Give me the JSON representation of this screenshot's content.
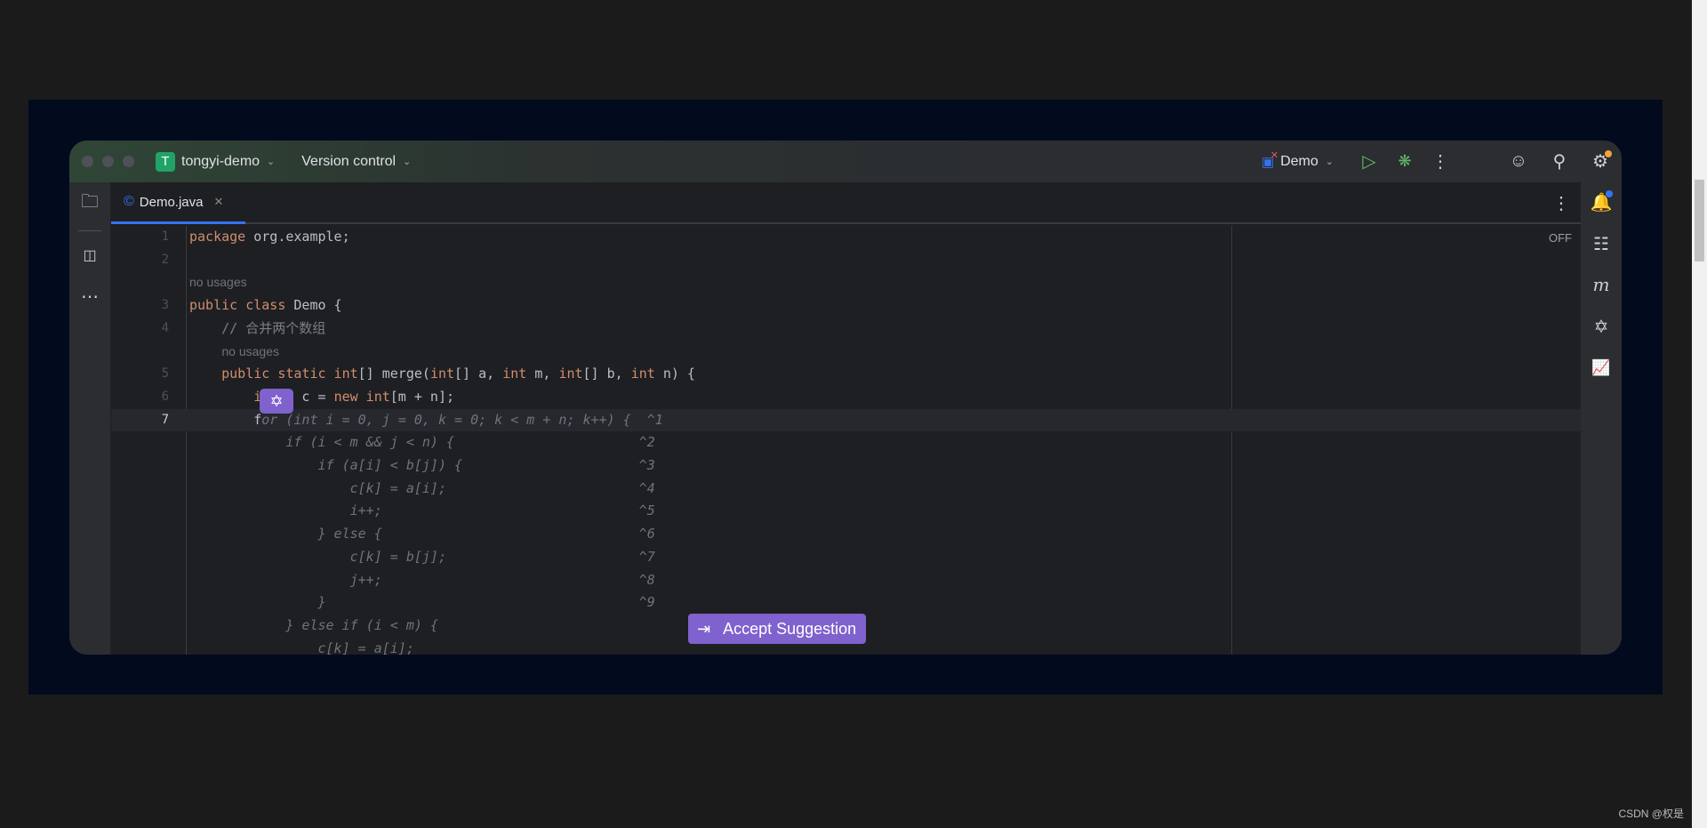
{
  "titlebar": {
    "project_initial": "T",
    "project": "tongyi-demo",
    "vcs": "Version control",
    "run_config": "Demo"
  },
  "tab": {
    "file": "Demo.java"
  },
  "editor": {
    "status": "OFF",
    "rows": [
      {
        "num": "1",
        "tokens": [
          {
            "t": "package ",
            "c": "kw"
          },
          {
            "t": "org.example;",
            "c": "pl"
          }
        ]
      },
      {
        "num": "2",
        "tokens": []
      },
      {
        "num": "",
        "hint": "no usages",
        "indent": 0
      },
      {
        "num": "3",
        "tokens": [
          {
            "t": "public class ",
            "c": "kw"
          },
          {
            "t": "Demo {",
            "c": "pl"
          }
        ]
      },
      {
        "num": "4",
        "tokens": [
          {
            "t": "    // 合并两个数组",
            "c": "cm"
          }
        ]
      },
      {
        "num": "",
        "hint": "no usages",
        "indent": 4
      },
      {
        "num": "5",
        "tokens": [
          {
            "t": "    public static int",
            "c": "kw"
          },
          {
            "t": "[] merge(",
            "c": "pl"
          },
          {
            "t": "int",
            "c": "kw"
          },
          {
            "t": "[] a, ",
            "c": "pl"
          },
          {
            "t": "int",
            "c": "kw"
          },
          {
            "t": " m, ",
            "c": "pl"
          },
          {
            "t": "int",
            "c": "kw"
          },
          {
            "t": "[] b, ",
            "c": "pl"
          },
          {
            "t": "int",
            "c": "kw"
          },
          {
            "t": " n) {",
            "c": "pl"
          }
        ]
      },
      {
        "num": "6",
        "tokens": [
          {
            "t": "        i",
            "c": "kw"
          },
          {
            "t": "nt[] c = ",
            "c": "pl"
          },
          {
            "t": "new int",
            "c": "kw"
          },
          {
            "t": "[m + n];",
            "c": "pl"
          }
        ]
      },
      {
        "num": "7",
        "current": true,
        "tokens": [
          {
            "t": "        f",
            "c": "pl"
          },
          {
            "t": "or (int i = 0, j = 0, k = 0; k < m + n; k++) {  ^1",
            "c": "gh"
          }
        ]
      },
      {
        "num": "",
        "tokens": [
          {
            "t": "            if (i < m && j < n) {                       ^2",
            "c": "gh"
          }
        ]
      },
      {
        "num": "",
        "tokens": [
          {
            "t": "                if (a[i] < b[j]) {                      ^3",
            "c": "gh"
          }
        ]
      },
      {
        "num": "",
        "tokens": [
          {
            "t": "                    c[k] = a[i];                        ^4",
            "c": "gh"
          }
        ]
      },
      {
        "num": "",
        "tokens": [
          {
            "t": "                    i++;                                ^5",
            "c": "gh"
          }
        ]
      },
      {
        "num": "",
        "tokens": [
          {
            "t": "                } else {                                ^6",
            "c": "gh"
          }
        ]
      },
      {
        "num": "",
        "tokens": [
          {
            "t": "                    c[k] = b[j];                        ^7",
            "c": "gh"
          }
        ]
      },
      {
        "num": "",
        "tokens": [
          {
            "t": "                    j++;                                ^8",
            "c": "gh"
          }
        ]
      },
      {
        "num": "",
        "tokens": [
          {
            "t": "                }                                       ^9",
            "c": "gh"
          }
        ]
      },
      {
        "num": "",
        "tokens": [
          {
            "t": "            } else if (i < m) {",
            "c": "gh"
          }
        ]
      },
      {
        "num": "",
        "tokens": [
          {
            "t": "                c[k] = a[i];",
            "c": "gh"
          }
        ]
      }
    ]
  },
  "accept_button": "Accept Suggestion",
  "watermark": "CSDN @权是",
  "colors": {
    "accent": "#3574f0",
    "tongyi": "#7f62cd",
    "run": "#5fb865",
    "keyword": "#cf8e6d"
  }
}
